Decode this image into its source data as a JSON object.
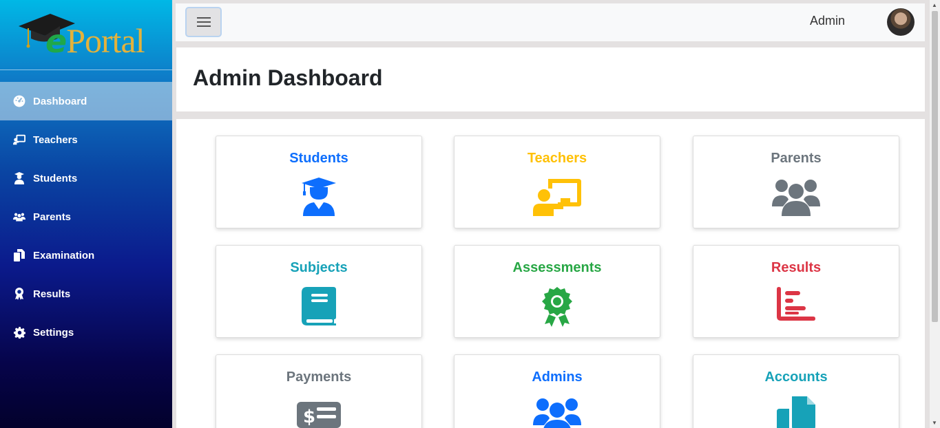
{
  "brand": {
    "logo_text": "Portal",
    "logo_letter": "e"
  },
  "sidebar": {
    "items": [
      {
        "label": "Dashboard",
        "icon": "tachometer-icon",
        "active": true
      },
      {
        "label": "Teachers",
        "icon": "chalkboard-teacher-icon"
      },
      {
        "label": "Students",
        "icon": "user-graduate-icon"
      },
      {
        "label": "Parents",
        "icon": "users-icon"
      },
      {
        "label": "Examination",
        "icon": "copy-icon"
      },
      {
        "label": "Results",
        "icon": "award-icon"
      },
      {
        "label": "Settings",
        "icon": "gear-icon"
      }
    ]
  },
  "topbar": {
    "menu_icon": "hamburger-icon",
    "user_name": "Admin",
    "avatar_icon": "user-avatar"
  },
  "page": {
    "title": "Admin Dashboard"
  },
  "cards": [
    {
      "label": "Students",
      "color": "#0d6efd",
      "icon": "user-graduate-icon"
    },
    {
      "label": "Teachers",
      "color": "#ffc107",
      "icon": "chalkboard-teacher-icon"
    },
    {
      "label": "Parents",
      "color": "#6c757d",
      "icon": "users-icon"
    },
    {
      "label": "Subjects",
      "color": "#17a2b8",
      "icon": "book-icon"
    },
    {
      "label": "Assessments",
      "color": "#28a745",
      "icon": "award-icon"
    },
    {
      "label": "Results",
      "color": "#dc3545",
      "icon": "chart-bar-icon"
    },
    {
      "label": "Payments",
      "color": "#6c757d",
      "icon": "money-check-icon"
    },
    {
      "label": "Admins",
      "color": "#0d6efd",
      "icon": "users-icon"
    },
    {
      "label": "Accounts",
      "color": "#17a2b8",
      "icon": "copy-icon"
    }
  ]
}
